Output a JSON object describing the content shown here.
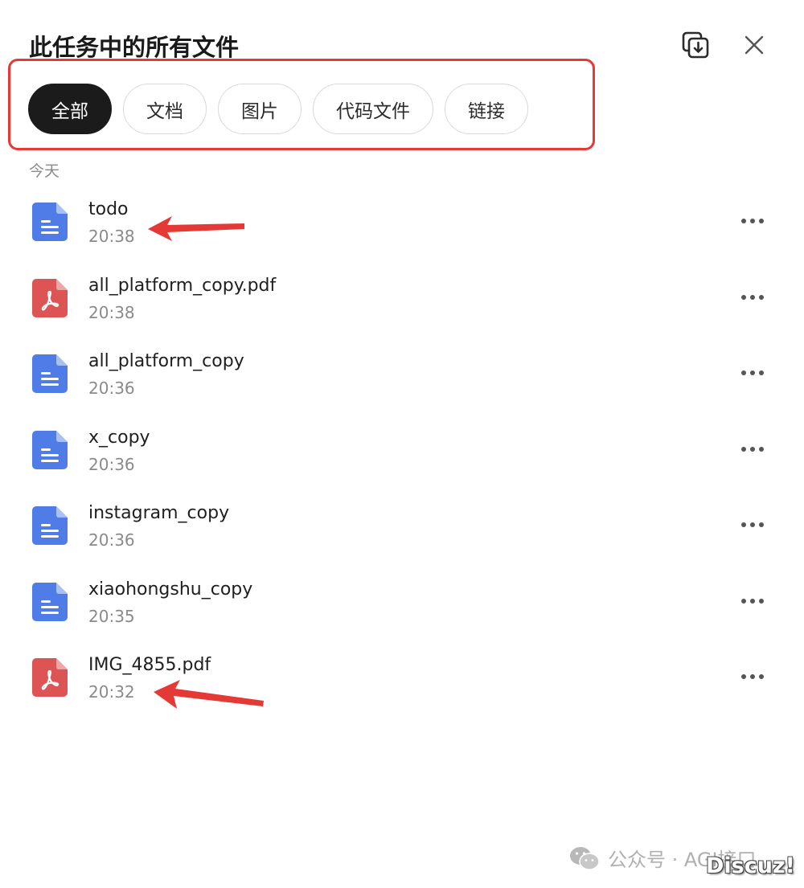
{
  "header": {
    "title": "此任务中的所有文件",
    "download_icon": "download-copy-icon",
    "close_icon": "close-icon"
  },
  "filters": [
    {
      "label": "全部",
      "active": true
    },
    {
      "label": "文档",
      "active": false
    },
    {
      "label": "图片",
      "active": false
    },
    {
      "label": "代码文件",
      "active": false
    },
    {
      "label": "链接",
      "active": false
    }
  ],
  "section_label": "今天",
  "files": [
    {
      "name": "todo",
      "time": "20:38",
      "type": "doc"
    },
    {
      "name": "all_platform_copy.pdf",
      "time": "20:38",
      "type": "pdf"
    },
    {
      "name": "all_platform_copy",
      "time": "20:36",
      "type": "doc"
    },
    {
      "name": "x_copy",
      "time": "20:36",
      "type": "doc"
    },
    {
      "name": "instagram_copy",
      "time": "20:36",
      "type": "doc"
    },
    {
      "name": "xiaohongshu_copy",
      "time": "20:35",
      "type": "doc"
    },
    {
      "name": "IMG_4855.pdf",
      "time": "20:32",
      "type": "pdf"
    }
  ],
  "watermark": {
    "text": "公众号 · AGI接口",
    "icon": "wechat-icon",
    "badge": "Discuz!"
  },
  "colors": {
    "accent_red": "#e53935",
    "doc_blue": "#4f7ce6",
    "pdf_red": "#dd5454",
    "active_tab": "#1b1b1b"
  }
}
